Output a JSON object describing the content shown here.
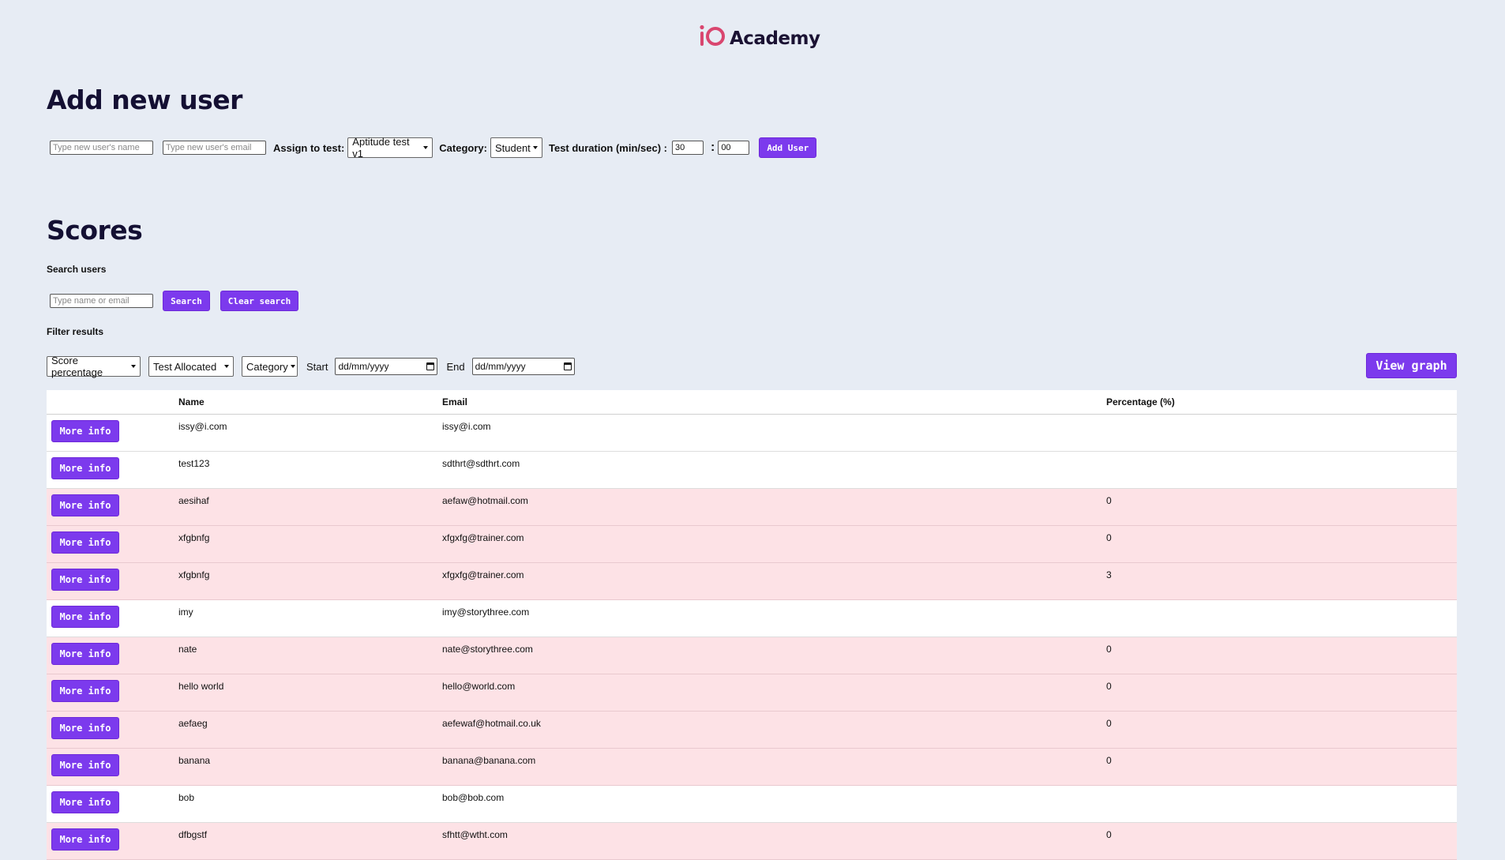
{
  "brand": {
    "name": "Academy"
  },
  "add_user": {
    "title": "Add new user",
    "name_placeholder": "Type new user's name",
    "email_placeholder": "Type new user's email",
    "assign_label": "Assign to test:",
    "assign_value": "Aptitude test v1",
    "category_label": "Category:",
    "category_value": "Student",
    "duration_label": "Test duration (min/sec) :",
    "minutes": "30",
    "separator": ":",
    "seconds": "00",
    "submit_label": "Add User"
  },
  "scores": {
    "title": "Scores",
    "search_heading": "Search users",
    "search_placeholder": "Type name or email",
    "search_label": "Search",
    "clear_label": "Clear search",
    "filter_heading": "Filter results",
    "filters": {
      "score": "Score percentage",
      "test": "Test Allocated",
      "category": "Category",
      "start_label": "Start",
      "start_value": "dd/mm/yyyy",
      "end_label": "End",
      "end_value": "dd/mm/yyyy"
    },
    "view_graph_label": "View graph",
    "columns": {
      "name": "Name",
      "email": "Email",
      "percentage": "Percentage (%)"
    },
    "more_label": "More info",
    "rows": [
      {
        "name": "issy@i.com",
        "email": "issy@i.com",
        "pct": "",
        "tone": "white"
      },
      {
        "name": "test123",
        "email": "sdthrt@sdthrt.com",
        "pct": "",
        "tone": "white"
      },
      {
        "name": "aesihaf",
        "email": "aefaw@hotmail.com",
        "pct": "0",
        "tone": "pink"
      },
      {
        "name": "xfgbnfg",
        "email": "xfgxfg@trainer.com",
        "pct": "0",
        "tone": "pink"
      },
      {
        "name": "xfgbnfg",
        "email": "xfgxfg@trainer.com",
        "pct": "3",
        "tone": "pink"
      },
      {
        "name": "imy",
        "email": "imy@storythree.com",
        "pct": "",
        "tone": "white"
      },
      {
        "name": "nate",
        "email": "nate@storythree.com",
        "pct": "0",
        "tone": "pink"
      },
      {
        "name": "hello world",
        "email": "hello@world.com",
        "pct": "0",
        "tone": "pink"
      },
      {
        "name": "aefaeg",
        "email": "aefewaf@hotmail.co.uk",
        "pct": "0",
        "tone": "pink"
      },
      {
        "name": "banana",
        "email": "banana@banana.com",
        "pct": "0",
        "tone": "pink"
      },
      {
        "name": "bob",
        "email": "bob@bob.com",
        "pct": "",
        "tone": "white"
      },
      {
        "name": "dfbgstf",
        "email": "sfhtt@wtht.com",
        "pct": "0",
        "tone": "pink"
      }
    ]
  },
  "colors": {
    "accent": "#7c3aed",
    "pink_row": "#fde2e6",
    "background": "#e7ecf4",
    "logo": "#e0407b"
  },
  "icons": [
    "io-logo-icon",
    "dropdown-caret-icon",
    "calendar-icon"
  ]
}
